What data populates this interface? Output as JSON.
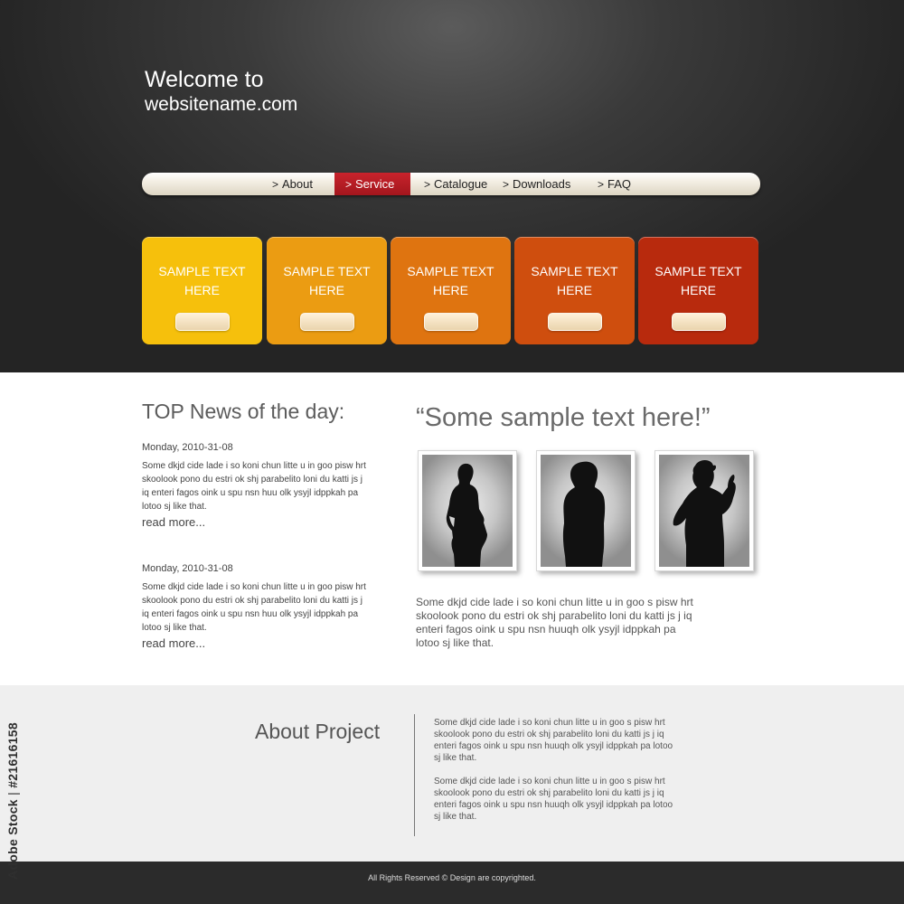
{
  "header": {
    "welcome_line1": "Welcome to",
    "welcome_line2": "websitename.com"
  },
  "nav": {
    "items": [
      {
        "label": "About",
        "active": false
      },
      {
        "label": "Service",
        "active": true
      },
      {
        "label": "Catalogue",
        "active": false
      },
      {
        "label": "Downloads",
        "active": false
      },
      {
        "label": "FAQ",
        "active": false
      }
    ],
    "arrow_icon": "chevron-right-icon",
    "active_color": "#b81d25"
  },
  "cards": [
    {
      "line1": "SAMPLE TEXT",
      "line2": "HERE",
      "color": "#f6c00c"
    },
    {
      "line1": "SAMPLE TEXT",
      "line2": "HERE",
      "color": "#eb9c12"
    },
    {
      "line1": "SAMPLE TEXT",
      "line2": "HERE",
      "color": "#df7410"
    },
    {
      "line1": "SAMPLE TEXT",
      "line2": "HERE",
      "color": "#cf4e0e"
    },
    {
      "line1": "SAMPLE TEXT",
      "line2": "HERE",
      "color": "#b82a0d"
    }
  ],
  "news": {
    "title": "TOP News of the day:",
    "items": [
      {
        "date": "Monday, 2010-31-08",
        "body": "Some dkjd  cide lade i so koni chun litte u in goo pisw hrt skoolook pono du estri ok shj parabelito loni du katti js j iq enteri fagos oink u spu nsn huu olk ysyjl idppkah pa lotoo sj like that.",
        "more": "read more..."
      },
      {
        "date": "Monday, 2010-31-08",
        "body": "Some dkjd  cide lade i so koni chun litte u in goo pisw hrt skoolook pono du estri ok shj parabelito loni du katti js j iq enteri fagos oink u spu nsn huu olk ysyjl idppkah pa lotoo sj like that.",
        "more": "read more..."
      }
    ]
  },
  "feature": {
    "quote": "“Some sample text here!”",
    "text": "Some dkjd  cide lade i so koni chun litte u in goo s pisw hrt skoolook pono du estri ok shj parabelito loni du katti js j iq enteri fagos oink u spu nsn huuqh olk ysyjl idppkah pa lotoo sj like that.",
    "photos": [
      "silhouette-woman-hand-on-hip",
      "silhouette-woman-short-hair",
      "silhouette-man-waving"
    ]
  },
  "about": {
    "title": "About Project",
    "para1": "Some dkjd  cide lade i so koni chun litte u in goo s pisw hrt skoolook pono du estri ok shj parabelito loni du katti js j iq enteri fagos oink u spu nsn huuqh olk ysyjl idppkah pa lotoo sj like that.",
    "para2": "Some dkjd  cide lade i so koni chun litte u in goo s pisw hrt skoolook pono du estri ok shj parabelito loni du katti js j iq enteri fagos oink u spu nsn huuqh olk ysyjl idppkah pa lotoo sj like that."
  },
  "footer": {
    "text": "All Rights Reserved ©  Design are copyrighted."
  },
  "watermark": {
    "brand": "Adobe Stock",
    "separator": " | ",
    "id": "#21616158"
  }
}
